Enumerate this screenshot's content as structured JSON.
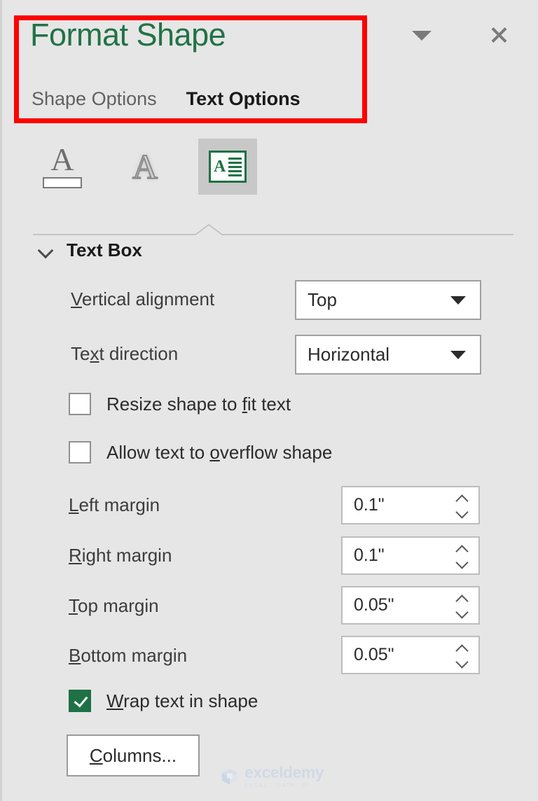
{
  "panel": {
    "title": "Format Shape",
    "caret_icon": "chevron-down-icon",
    "close_icon": "close-icon"
  },
  "tabs": [
    {
      "label": "Shape Options",
      "active": false
    },
    {
      "label": "Text Options",
      "active": true
    }
  ],
  "icon_strip": [
    {
      "name": "text-fill-icon",
      "letter": "A",
      "selected": false
    },
    {
      "name": "text-effects-icon",
      "letter": "A",
      "selected": false
    },
    {
      "name": "text-box-icon",
      "letter": "A",
      "selected": true
    }
  ],
  "section": {
    "title": "Text Box",
    "expanded": true
  },
  "fields": {
    "vertical_alignment": {
      "label_pre": "",
      "label_accel": "V",
      "label_post": "ertical alignment",
      "value": "Top"
    },
    "text_direction": {
      "label_pre": "Te",
      "label_accel": "x",
      "label_post": "t direction",
      "value": "Horizontal"
    },
    "resize_shape": {
      "label_pre": "Resize shape to ",
      "label_accel": "f",
      "label_post": "it text",
      "checked": false
    },
    "allow_overflow": {
      "label_pre": "Allow text to ",
      "label_accel": "o",
      "label_post": "verflow shape",
      "checked": false
    },
    "left_margin": {
      "label_pre": "",
      "label_accel": "L",
      "label_post": "eft margin",
      "value": "0.1\""
    },
    "right_margin": {
      "label_pre": "",
      "label_accel": "R",
      "label_post": "ight margin",
      "value": "0.1\""
    },
    "top_margin": {
      "label_pre": "",
      "label_accel": "T",
      "label_post": "op margin",
      "value": "0.05\""
    },
    "bottom_margin": {
      "label_pre": "",
      "label_accel": "B",
      "label_post": "ottom margin",
      "value": "0.05\""
    },
    "wrap_text": {
      "label_pre": "",
      "label_accel": "W",
      "label_post": "rap text in shape",
      "checked": true
    },
    "columns_button": {
      "label_pre": "",
      "label_accel": "C",
      "label_post": "olumns..."
    }
  },
  "watermark": {
    "name": "exceldemy",
    "tagline": "EXCEL · DATA · BI"
  },
  "colors": {
    "panel_bg": "#e6e6e6",
    "title_green": "#217346",
    "annotation_red": "#ff0000",
    "checkbox_green": "#1e7145"
  }
}
